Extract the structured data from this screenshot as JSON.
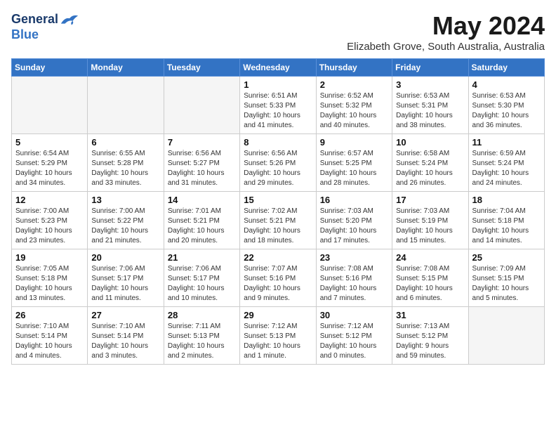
{
  "header": {
    "logo_line1": "General",
    "logo_line2": "Blue",
    "month": "May 2024",
    "location": "Elizabeth Grove, South Australia, Australia"
  },
  "days_of_week": [
    "Sunday",
    "Monday",
    "Tuesday",
    "Wednesday",
    "Thursday",
    "Friday",
    "Saturday"
  ],
  "weeks": [
    [
      {
        "day": "",
        "info": ""
      },
      {
        "day": "",
        "info": ""
      },
      {
        "day": "",
        "info": ""
      },
      {
        "day": "1",
        "info": "Sunrise: 6:51 AM\nSunset: 5:33 PM\nDaylight: 10 hours\nand 41 minutes."
      },
      {
        "day": "2",
        "info": "Sunrise: 6:52 AM\nSunset: 5:32 PM\nDaylight: 10 hours\nand 40 minutes."
      },
      {
        "day": "3",
        "info": "Sunrise: 6:53 AM\nSunset: 5:31 PM\nDaylight: 10 hours\nand 38 minutes."
      },
      {
        "day": "4",
        "info": "Sunrise: 6:53 AM\nSunset: 5:30 PM\nDaylight: 10 hours\nand 36 minutes."
      }
    ],
    [
      {
        "day": "5",
        "info": "Sunrise: 6:54 AM\nSunset: 5:29 PM\nDaylight: 10 hours\nand 34 minutes."
      },
      {
        "day": "6",
        "info": "Sunrise: 6:55 AM\nSunset: 5:28 PM\nDaylight: 10 hours\nand 33 minutes."
      },
      {
        "day": "7",
        "info": "Sunrise: 6:56 AM\nSunset: 5:27 PM\nDaylight: 10 hours\nand 31 minutes."
      },
      {
        "day": "8",
        "info": "Sunrise: 6:56 AM\nSunset: 5:26 PM\nDaylight: 10 hours\nand 29 minutes."
      },
      {
        "day": "9",
        "info": "Sunrise: 6:57 AM\nSunset: 5:25 PM\nDaylight: 10 hours\nand 28 minutes."
      },
      {
        "day": "10",
        "info": "Sunrise: 6:58 AM\nSunset: 5:24 PM\nDaylight: 10 hours\nand 26 minutes."
      },
      {
        "day": "11",
        "info": "Sunrise: 6:59 AM\nSunset: 5:24 PM\nDaylight: 10 hours\nand 24 minutes."
      }
    ],
    [
      {
        "day": "12",
        "info": "Sunrise: 7:00 AM\nSunset: 5:23 PM\nDaylight: 10 hours\nand 23 minutes."
      },
      {
        "day": "13",
        "info": "Sunrise: 7:00 AM\nSunset: 5:22 PM\nDaylight: 10 hours\nand 21 minutes."
      },
      {
        "day": "14",
        "info": "Sunrise: 7:01 AM\nSunset: 5:21 PM\nDaylight: 10 hours\nand 20 minutes."
      },
      {
        "day": "15",
        "info": "Sunrise: 7:02 AM\nSunset: 5:21 PM\nDaylight: 10 hours\nand 18 minutes."
      },
      {
        "day": "16",
        "info": "Sunrise: 7:03 AM\nSunset: 5:20 PM\nDaylight: 10 hours\nand 17 minutes."
      },
      {
        "day": "17",
        "info": "Sunrise: 7:03 AM\nSunset: 5:19 PM\nDaylight: 10 hours\nand 15 minutes."
      },
      {
        "day": "18",
        "info": "Sunrise: 7:04 AM\nSunset: 5:18 PM\nDaylight: 10 hours\nand 14 minutes."
      }
    ],
    [
      {
        "day": "19",
        "info": "Sunrise: 7:05 AM\nSunset: 5:18 PM\nDaylight: 10 hours\nand 13 minutes."
      },
      {
        "day": "20",
        "info": "Sunrise: 7:06 AM\nSunset: 5:17 PM\nDaylight: 10 hours\nand 11 minutes."
      },
      {
        "day": "21",
        "info": "Sunrise: 7:06 AM\nSunset: 5:17 PM\nDaylight: 10 hours\nand 10 minutes."
      },
      {
        "day": "22",
        "info": "Sunrise: 7:07 AM\nSunset: 5:16 PM\nDaylight: 10 hours\nand 9 minutes."
      },
      {
        "day": "23",
        "info": "Sunrise: 7:08 AM\nSunset: 5:16 PM\nDaylight: 10 hours\nand 7 minutes."
      },
      {
        "day": "24",
        "info": "Sunrise: 7:08 AM\nSunset: 5:15 PM\nDaylight: 10 hours\nand 6 minutes."
      },
      {
        "day": "25",
        "info": "Sunrise: 7:09 AM\nSunset: 5:15 PM\nDaylight: 10 hours\nand 5 minutes."
      }
    ],
    [
      {
        "day": "26",
        "info": "Sunrise: 7:10 AM\nSunset: 5:14 PM\nDaylight: 10 hours\nand 4 minutes."
      },
      {
        "day": "27",
        "info": "Sunrise: 7:10 AM\nSunset: 5:14 PM\nDaylight: 10 hours\nand 3 minutes."
      },
      {
        "day": "28",
        "info": "Sunrise: 7:11 AM\nSunset: 5:13 PM\nDaylight: 10 hours\nand 2 minutes."
      },
      {
        "day": "29",
        "info": "Sunrise: 7:12 AM\nSunset: 5:13 PM\nDaylight: 10 hours\nand 1 minute."
      },
      {
        "day": "30",
        "info": "Sunrise: 7:12 AM\nSunset: 5:12 PM\nDaylight: 10 hours\nand 0 minutes."
      },
      {
        "day": "31",
        "info": "Sunrise: 7:13 AM\nSunset: 5:12 PM\nDaylight: 9 hours\nand 59 minutes."
      },
      {
        "day": "",
        "info": ""
      }
    ]
  ]
}
